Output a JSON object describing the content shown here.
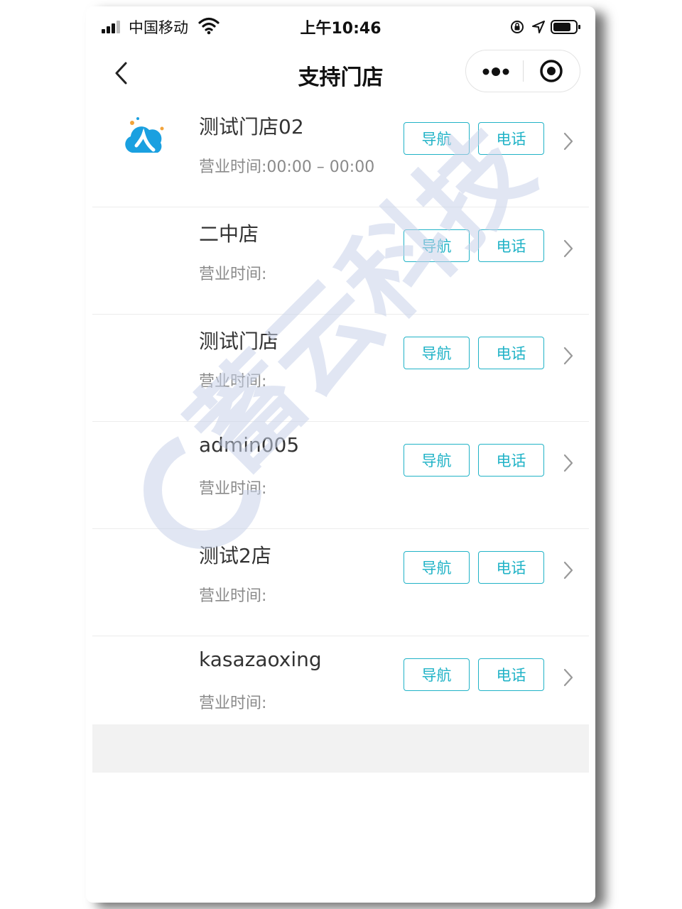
{
  "status_bar": {
    "carrier": "中国移动",
    "time": "上午10:46"
  },
  "nav": {
    "title": "支持门店"
  },
  "stores": [
    {
      "name": "测试门店02",
      "hours": "营业时间:00:00 – 00:00",
      "has_logo": true
    },
    {
      "name": "二中店",
      "hours": "营业时间:",
      "has_logo": false
    },
    {
      "name": "测试门店",
      "hours": "营业时间:",
      "has_logo": false
    },
    {
      "name": "admin005",
      "hours": "营业时间:",
      "has_logo": false
    },
    {
      "name": "测试2店",
      "hours": "营业时间:",
      "has_logo": false
    },
    {
      "name": "kasazaoxing",
      "hours": "营业时间:",
      "has_logo": false
    }
  ],
  "buttons": {
    "navigate": "导航",
    "call": "电话"
  },
  "watermark": {
    "text": "蓄云科技"
  },
  "colors": {
    "accent": "#21b3c7",
    "logo_blue": "#1aa0e0",
    "watermark": "#c9d3ea"
  },
  "icons": {
    "back": "chevron-left-icon",
    "more": "more-dots-icon",
    "close": "target-circle-icon",
    "row_arrow": "chevron-right-icon"
  }
}
